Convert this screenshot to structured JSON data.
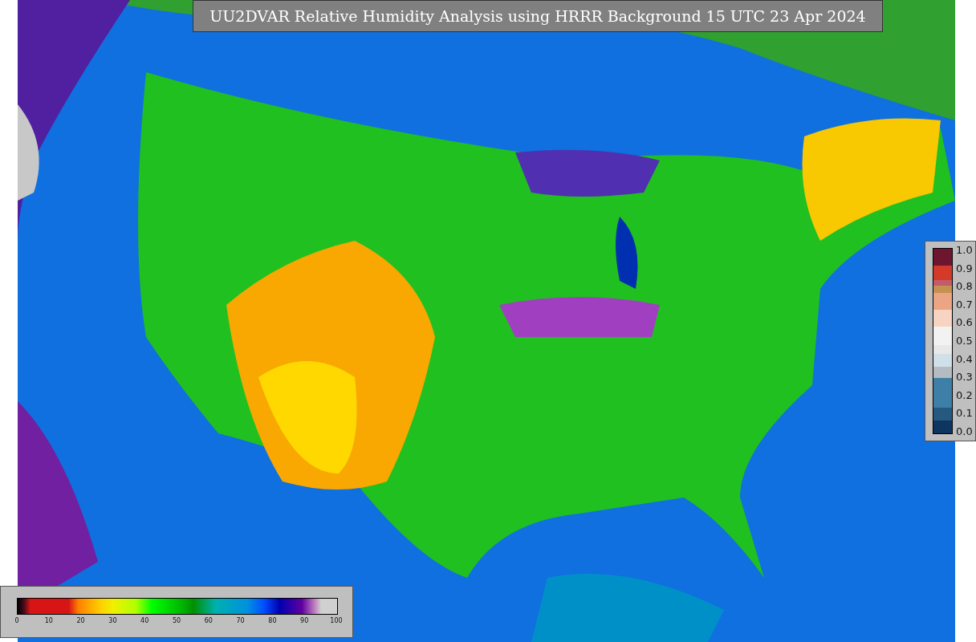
{
  "title": "UU2DVAR Relative Humidity Analysis using HRRR Background 15 UTC 23 Apr 2024",
  "ratio_colorbar": {
    "ticks": [
      "1.0",
      "0.9",
      "0.8",
      "0.7",
      "0.6",
      "0.5",
      "0.4",
      "0.3",
      "0.2",
      "0.1",
      "0.0"
    ]
  },
  "humidity_colorbar": {
    "ticks": [
      "0",
      "10",
      "20",
      "30",
      "40",
      "50",
      "60",
      "70",
      "80",
      "90",
      "100"
    ]
  }
}
